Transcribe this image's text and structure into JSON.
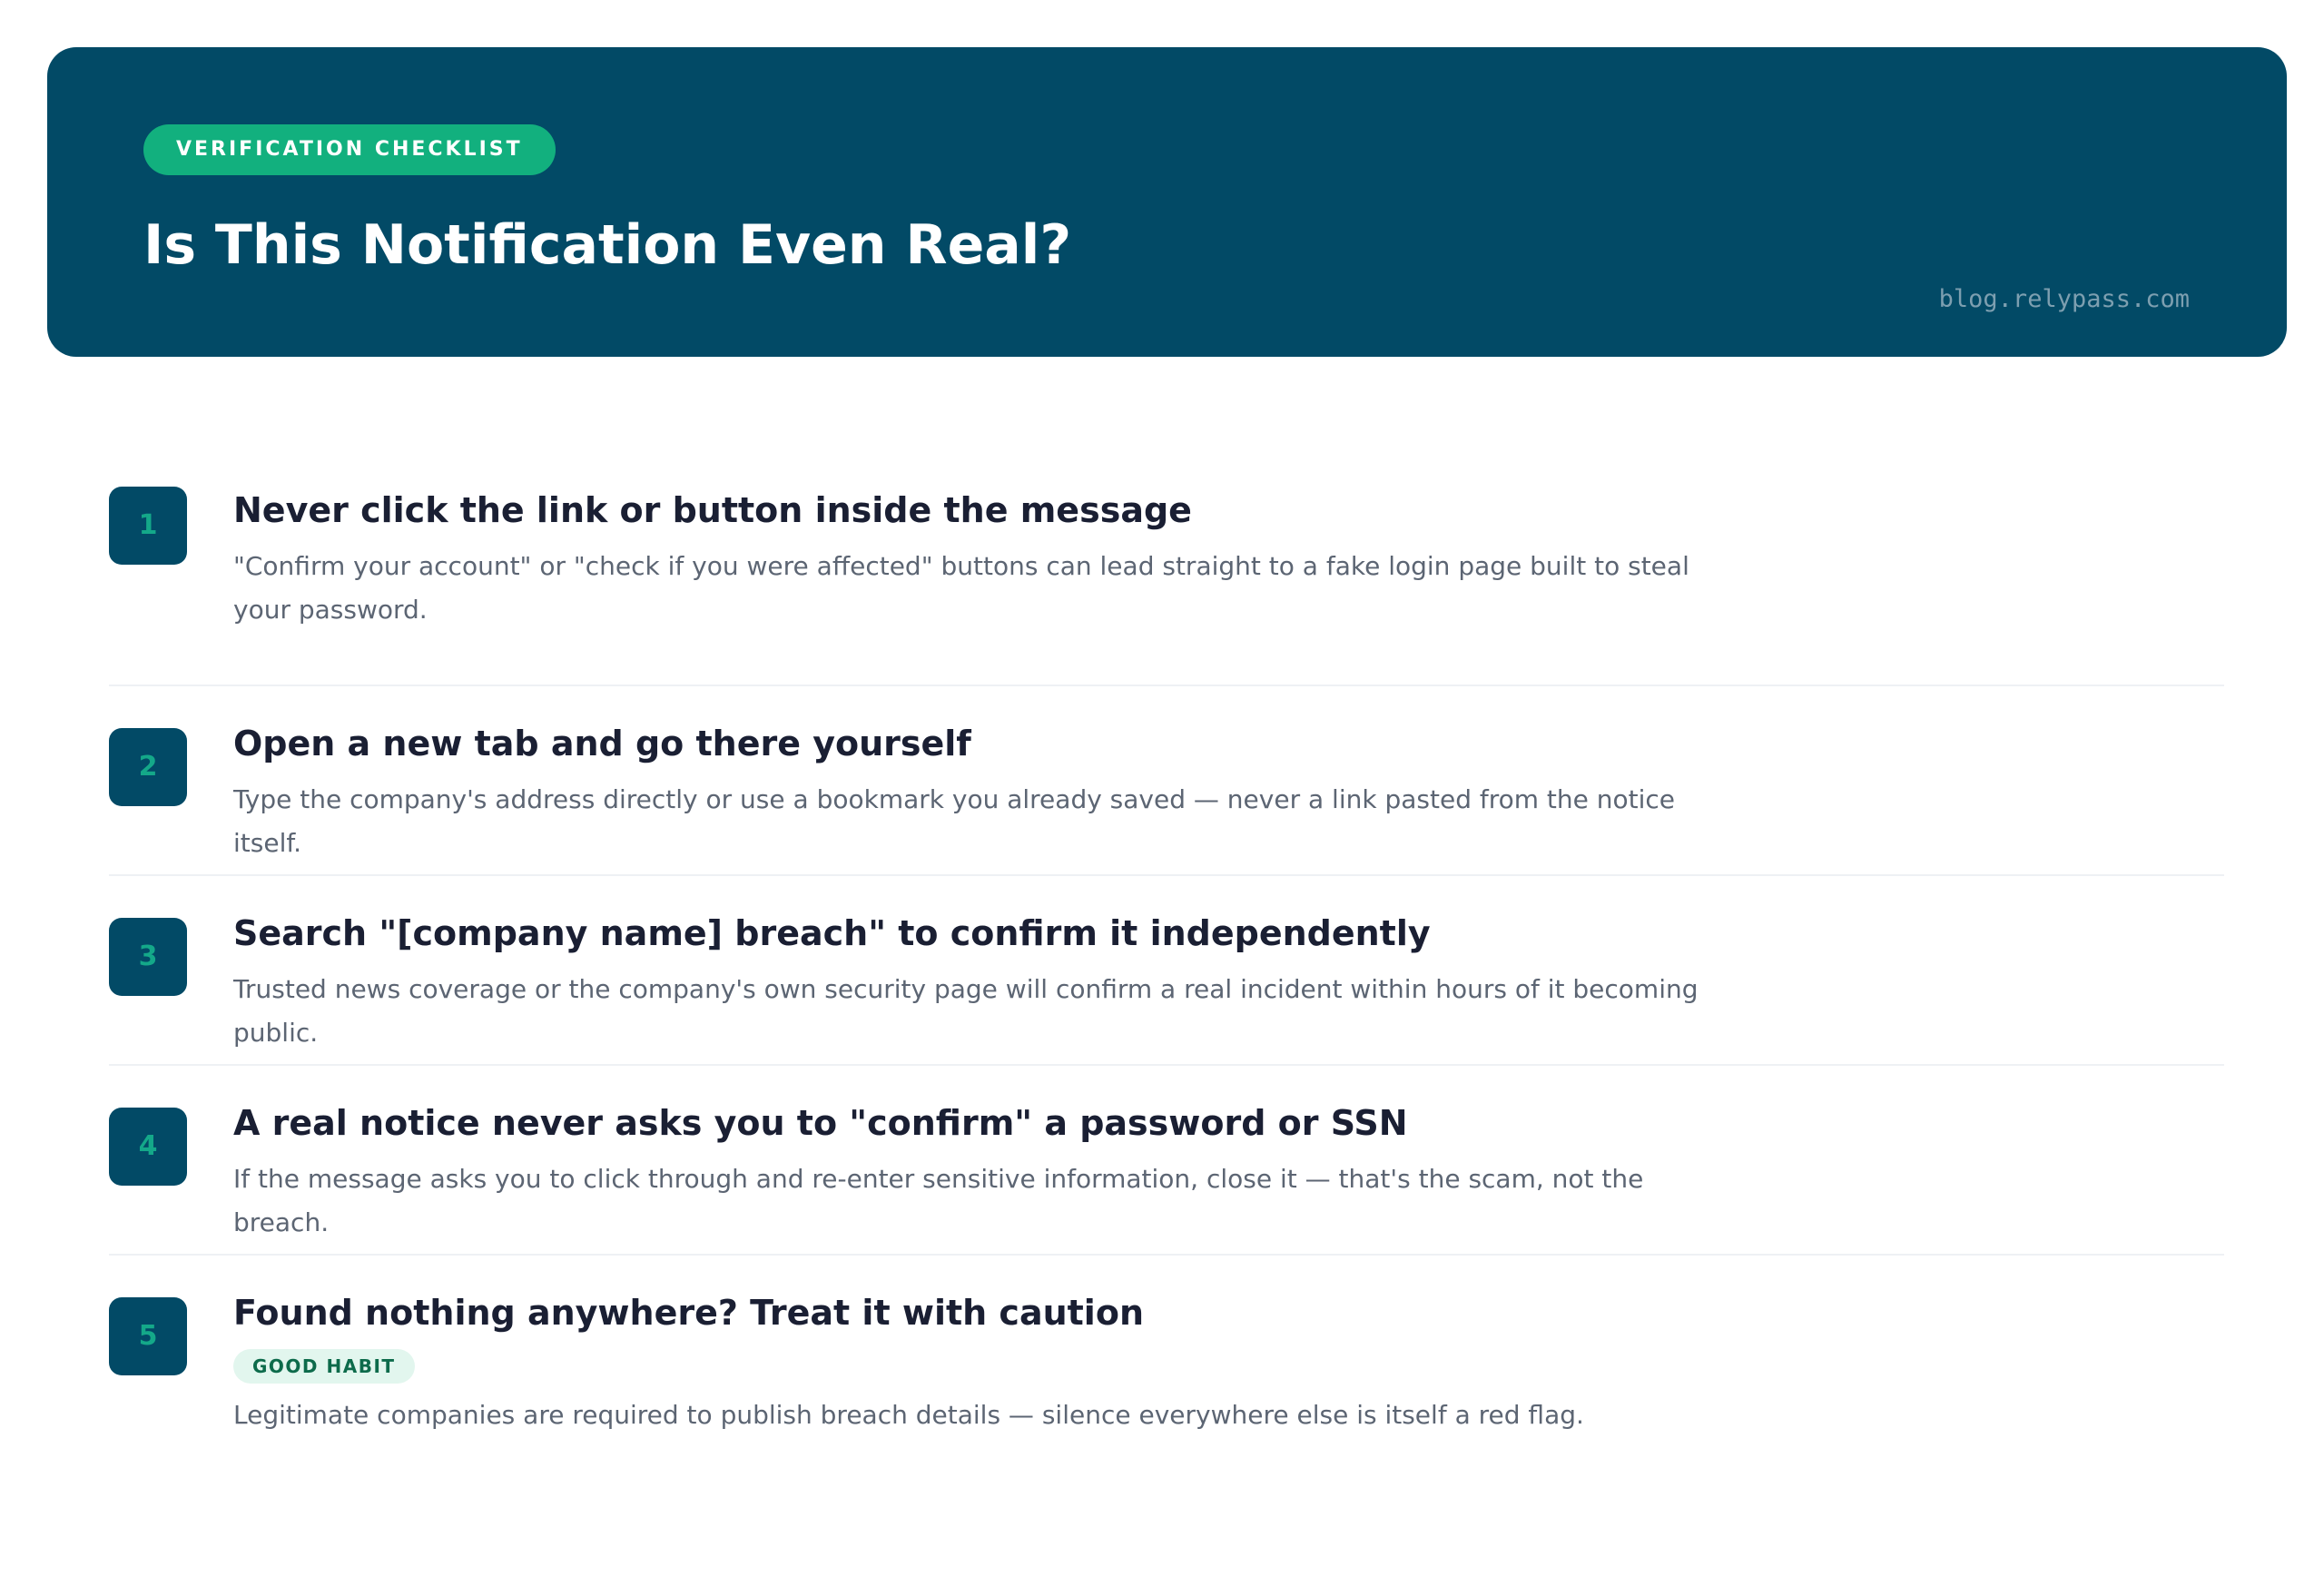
{
  "header": {
    "badge": "VERIFICATION CHECKLIST",
    "title": "Is This Notification Even Real?",
    "domain": "blog.relypass.com"
  },
  "steps": [
    {
      "number": "1",
      "title": "Never click the link or button inside the message",
      "description": "\"Confirm your account\" or \"check if you were affected\" buttons can lead straight to a fake login page built to steal your password."
    },
    {
      "number": "2",
      "title": "Open a new tab and go there yourself",
      "description": "Type the company's address directly or use a bookmark you already saved — never a link pasted from the notice itself."
    },
    {
      "number": "3",
      "title": "Search \"[company name] breach\" to confirm it independently",
      "description": "Trusted news coverage or the company's own security page will confirm a real incident within hours of it becoming public."
    },
    {
      "number": "4",
      "title": "A real notice never asks you to \"confirm\" a password or SSN",
      "description": "If the message asks you to click through and re-enter sensitive information, close it — that's the scam, not the breach."
    },
    {
      "number": "5",
      "title": "Found nothing anywhere? Treat it with caution",
      "tag": "GOOD HABIT",
      "description": "Legitimate companies are required to publish breach details — silence everywhere else is itself a red flag."
    }
  ],
  "colors": {
    "header_bg": "#024a66",
    "accent_green": "#12b07e",
    "number_text": "#14a889",
    "tag_bg": "#e2f6ee",
    "tag_text": "#0d6b4b"
  }
}
